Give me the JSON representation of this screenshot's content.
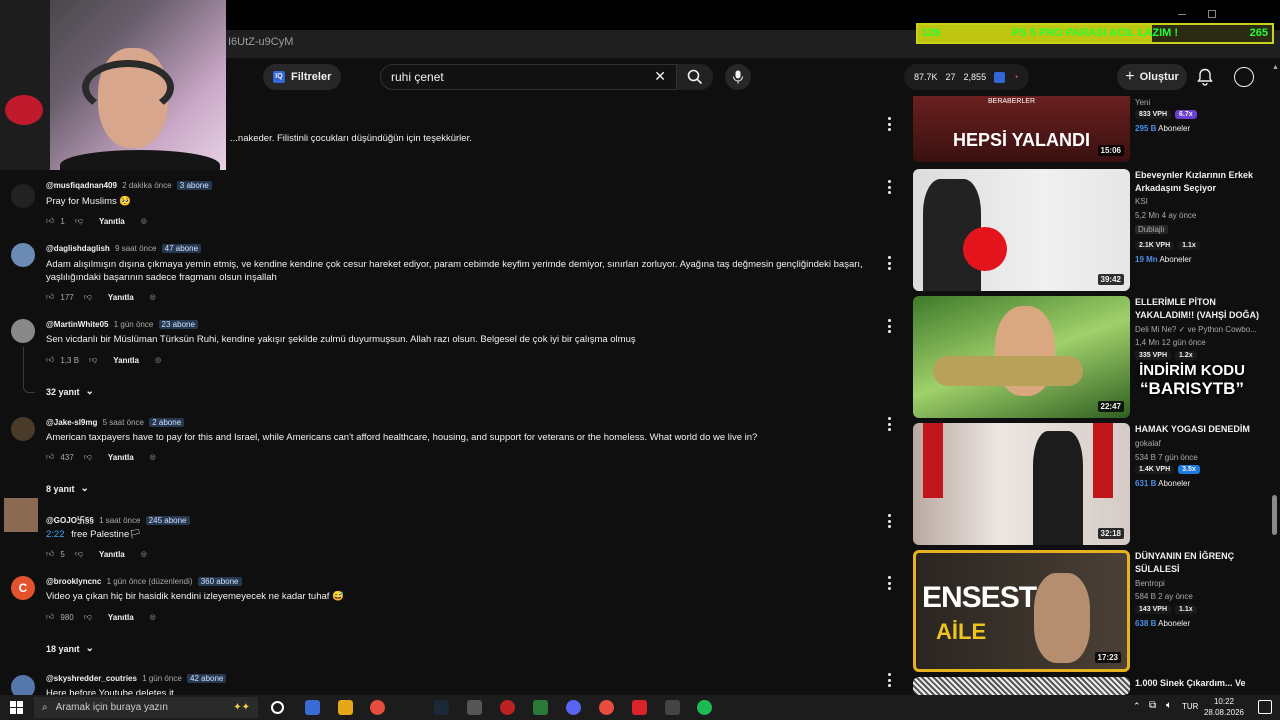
{
  "browser": {
    "url_fragment": "I6UtZ-u9CyM"
  },
  "overlay": {
    "goal_left": "126",
    "goal_title": "PS 5 PRO PARASI ACIL LAZIM !",
    "goal_right": "265",
    "goal_fraction": 0.66,
    "promo_line1": "İNDİRİM KODU",
    "promo_line2": "“BARISYTB”"
  },
  "toolbar": {
    "filters_label": "Filtreler",
    "search_value": "ruhi çenet",
    "stats": [
      "87.7K",
      "27",
      "2,855"
    ],
    "create_label": "Oluştur"
  },
  "comments": [
    {
      "handle": "",
      "time": "",
      "subs": "",
      "text": "...nakeder. Filistinli çocukları düşündüğün için teşekkürler.",
      "likes": "",
      "reply": "",
      "replies": ""
    },
    {
      "handle": "@musfiqadnan409",
      "time": "2 dakika önce",
      "subs": "3 abone",
      "text": "Pray for Muslims 🥺",
      "likes": "1",
      "reply": "Yanıtla",
      "replies": ""
    },
    {
      "handle": "@daglishdaglish",
      "time": "9 saat önce",
      "subs": "47 abone",
      "text": "Adam alışılmışın dışına çıkmaya yemin etmiş, ve kendine kendine çok cesur hareket ediyor, param cebimde keyfim yerimde demiyor, sınırları zorluyor. Ayağına taş değmesin gençliğindeki başarı, yaşlılığındaki başarının sadece fragmanı olsun inşallah",
      "likes": "177",
      "reply": "Yanıtla",
      "replies": ""
    },
    {
      "handle": "@MartinWhite05",
      "time": "1 gün önce",
      "subs": "23 abone",
      "text": "Sen vicdanlı bir Müslüman Türksün Ruhi, kendine yakışır şekilde zulmü duyurmuşsun. Allah razı olsun. Belgesel de çok iyi bir çalışma olmuş",
      "likes": "1,3 B",
      "reply": "Yanıtla",
      "replies": "32 yanıt"
    },
    {
      "handle": "@Jake-sl9mg",
      "time": "5 saat önce",
      "subs": "2 abone",
      "text": "American taxpayers have to pay for this and Israel, while Americans can't afford healthcare, housing, and support for veterans or the homeless. What world do we live in?",
      "likes": "437",
      "reply": "Yanıtla",
      "replies": "8 yanıt"
    },
    {
      "handle": "@GOJO卐§§",
      "time": "1 saat önce",
      "subs": "245 abone",
      "timestamp": "2:22",
      "text": "free Palestine🏳",
      "likes": "5",
      "reply": "Yanıtla",
      "replies": ""
    },
    {
      "handle": "@brooklyncnc",
      "time": "1 gün önce (düzenlendi)",
      "subs": "360 abone",
      "text": "Video ya çıkan hiç bir hasidik kendini izleyemeyecek ne kadar tuhaf 😅",
      "likes": "980",
      "reply": "Yanıtla",
      "replies": "18 yanıt",
      "avatar_letter": "C"
    },
    {
      "handle": "@skyshredder_coutries",
      "time": "1 gün önce",
      "subs": "42 abone",
      "text": "Here before Youtube deletes it",
      "likes": "",
      "reply": "",
      "replies": ""
    }
  ],
  "related": [
    {
      "title": "",
      "channel": "Yeni",
      "stats": "",
      "vph": "833 VPH",
      "mult": "6.7x",
      "subs": "295 B",
      "subs_label": "Aboneler",
      "duration": "15:06",
      "thumb_text": "HEPSİ YALANDI",
      "thumb_small": "BERABERLER"
    },
    {
      "title": "Ebeveynler Kızlarının Erkek Arkadaşını Seçiyor",
      "channel": "KSI",
      "stats": "5,2 Mn  4 ay önce",
      "extra": "Dublajlı",
      "vph": "2.1K VPH",
      "mult": "1.1x",
      "subs": "19 Mn",
      "subs_label": "Aboneler",
      "duration": "39:42"
    },
    {
      "title": "ELLERİMLE PİTON YAKALADIM!! (VAHŞİ DOĞA)",
      "channel": "Deli Mi Ne? ✓ ve Python Cowbo...",
      "stats": "1,4 Mn  12 gün önce",
      "vph": "335 VPH",
      "mult": "1.2x",
      "subs": "",
      "subs_label": "",
      "duration": "22:47"
    },
    {
      "title": "HAMAK YOGASI DENEDİM",
      "channel": "gokalaf",
      "stats": "534 B  7 gün önce",
      "vph": "1.4K VPH",
      "mult": "3.5x",
      "subs": "631 B",
      "subs_label": "Aboneler",
      "duration": "32:18"
    },
    {
      "title": "DÜNYANIN EN İĞRENÇ SÜLALESİ",
      "channel": "Bentropi",
      "stats": "584 B  2 ay önce",
      "vph": "143 VPH",
      "mult": "1.1x",
      "subs": "638 B",
      "subs_label": "Aboneler",
      "duration": "17:23",
      "thumb_text": "ENSEST",
      "thumb_small": "AİLE"
    },
    {
      "title": "1.000 Sinek Çıkardım... Ve",
      "channel": "",
      "stats": "",
      "vph": "",
      "mult": "",
      "subs": "",
      "subs_label": "",
      "duration": ""
    }
  ],
  "taskbar": {
    "search_placeholder": "Aramak için buraya yazın",
    "lang": "TUR",
    "time": "10:22",
    "date": "28.08.2026"
  },
  "colors": {
    "background": "#0f0f0f",
    "subs_blue": "#4a8fe6",
    "goal_green": "#24ff34",
    "goal_fill": "#bfc60f"
  }
}
